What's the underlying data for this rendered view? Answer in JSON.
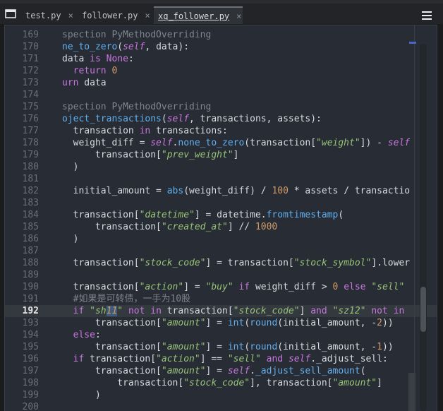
{
  "tabs": [
    {
      "label": "test.py",
      "close": "×"
    },
    {
      "label": "follower.py",
      "close": "×"
    },
    {
      "label": "xq_follower.py",
      "close": "×"
    }
  ],
  "menu_icon": "hamburger-icon",
  "window_icon": "window-icon",
  "current_line": 192,
  "lines": [
    {
      "n": "169",
      "t": "spection PyMethodOverriding"
    },
    {
      "n": "170",
      "t": "ne_to_zero(self, data):"
    },
    {
      "n": "171",
      "t": "data is None:"
    },
    {
      "n": "172",
      "t": "  return 0"
    },
    {
      "n": "173",
      "t": "urn data"
    },
    {
      "n": "174",
      "t": ""
    },
    {
      "n": "175",
      "t": "spection PyMethodOverriding"
    },
    {
      "n": "176",
      "t": "oject_transactions(self, transactions, assets):"
    },
    {
      "n": "177",
      "t": "  transaction in transactions:"
    },
    {
      "n": "178",
      "t": "  weight_diff = self.none_to_zero(transaction[\"weight\"]) - self"
    },
    {
      "n": "179",
      "t": "      transaction[\"prev_weight\"]"
    },
    {
      "n": "180",
      "t": "  )"
    },
    {
      "n": "181",
      "t": ""
    },
    {
      "n": "182",
      "t": "  initial_amount = abs(weight_diff) / 100 * assets / transactio"
    },
    {
      "n": "183",
      "t": ""
    },
    {
      "n": "184",
      "t": "  transaction[\"datetime\"] = datetime.fromtimestamp("
    },
    {
      "n": "185",
      "t": "      transaction[\"created_at\"] // 1000"
    },
    {
      "n": "186",
      "t": "  )"
    },
    {
      "n": "187",
      "t": ""
    },
    {
      "n": "188",
      "t": "  transaction[\"stock_code\"] = transaction[\"stock_symbol\"].lower"
    },
    {
      "n": "189",
      "t": ""
    },
    {
      "n": "190",
      "t": "  transaction[\"action\"] = \"buy\" if weight_diff > 0 else \"sell\""
    },
    {
      "n": "191",
      "t": "  #如果是可转债，一手为10股"
    },
    {
      "n": "192",
      "t": "  if \"sh11\" not in transaction[\"stock_code\"] and \"sz12\" not in"
    },
    {
      "n": "193",
      "t": "      transaction[\"amount\"] = int(round(initial_amount, -2))"
    },
    {
      "n": "194",
      "t": "  else:"
    },
    {
      "n": "195",
      "t": "      transaction[\"amount\"] = int(round(initial_amount, -1))"
    },
    {
      "n": "196",
      "t": "  if transaction[\"action\"] == \"sell\" and self._adjust_sell:"
    },
    {
      "n": "197",
      "t": "      transaction[\"amount\"] = self._adjust_sell_amount("
    },
    {
      "n": "198",
      "t": "          transaction[\"stock_code\"], transaction[\"amount\"]"
    },
    {
      "n": "199",
      "t": "      )"
    },
    {
      "n": "200",
      "t": ""
    }
  ]
}
